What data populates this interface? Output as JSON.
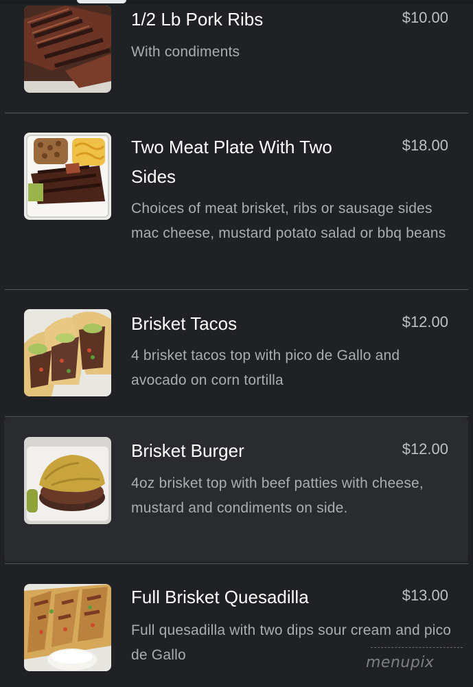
{
  "menu": {
    "items": [
      {
        "name": "1/2 Lb Pork Ribs",
        "price": "$10.00",
        "description": "With condiments",
        "image_icon": "pork-ribs-photo"
      },
      {
        "name": "Two Meat Plate With Two Sides",
        "price": "$18.00",
        "description": "Choices of meat brisket, ribs or sausage sides mac cheese, mustard potato salad or bbq beans",
        "image_icon": "meat-plate-photo"
      },
      {
        "name": "Brisket Tacos",
        "price": "$12.00",
        "description": "4 brisket tacos top with pico de Gallo and avocado on corn tortilla",
        "image_icon": "brisket-tacos-photo"
      },
      {
        "name": "Brisket Burger",
        "price": "$12.00",
        "description": "4oz brisket top with beef patties with cheese, mustard and condiments on side.",
        "image_icon": "brisket-burger-photo"
      },
      {
        "name": "Full Brisket Quesadilla",
        "price": "$13.00",
        "description": "Full quesadilla with two dips sour cream and pico de Gallo",
        "image_icon": "quesadilla-photo"
      }
    ]
  },
  "watermark": "menupix",
  "colors": {
    "background": "#202124",
    "highlight_background": "#2a2b2e",
    "title": "#ffffff",
    "price": "#bdc1c6",
    "description": "#a9adb2",
    "divider": "#55585c"
  }
}
